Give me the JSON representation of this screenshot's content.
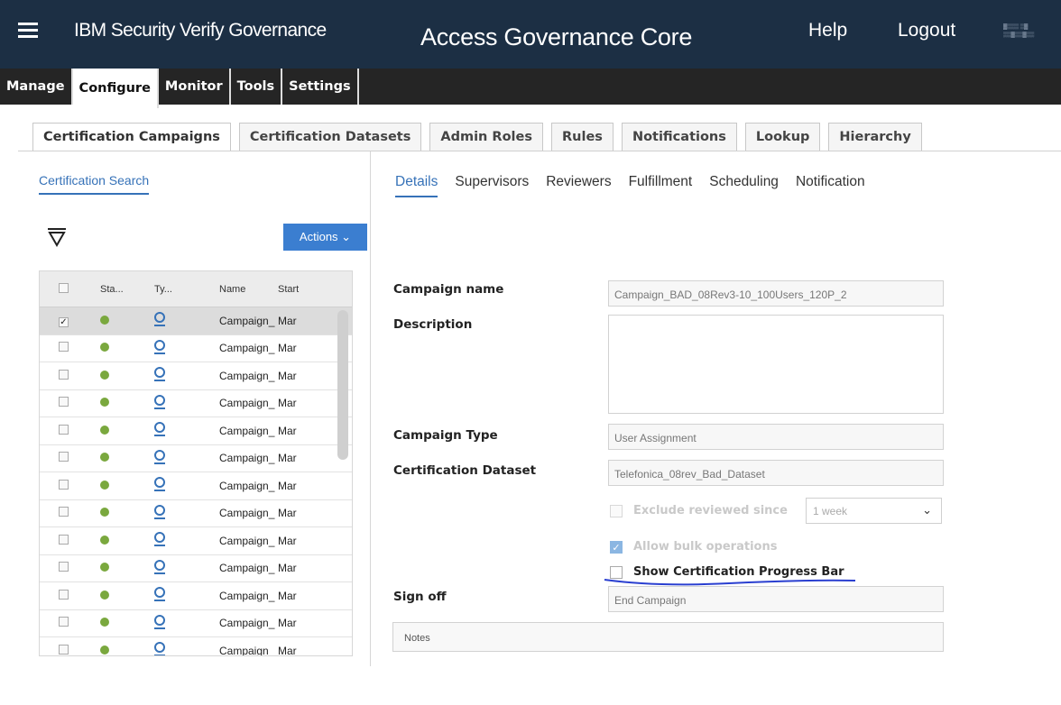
{
  "header": {
    "product": "IBM Security Verify Governance",
    "module": "Access Governance Core",
    "help": "Help",
    "logout": "Logout"
  },
  "menu": {
    "items": [
      "Manage",
      "Configure",
      "Monitor",
      "Tools",
      "Settings"
    ],
    "active": "Configure"
  },
  "subtabs": {
    "items": [
      "Certification Campaigns",
      "Certification Datasets",
      "Admin Roles",
      "Rules",
      "Notifications",
      "Lookup",
      "Hierarchy"
    ],
    "active": "Certification Campaigns"
  },
  "left": {
    "search_tab": "Certification Search",
    "actions_label": "Actions ⌄",
    "columns": [
      "Sta...",
      "Ty...",
      "Name",
      "Start"
    ],
    "rows": [
      {
        "name": "Campaign_",
        "start": "Mar",
        "checked": true
      },
      {
        "name": "Campaign_",
        "start": "Mar",
        "checked": false
      },
      {
        "name": "Campaign_",
        "start": "Mar",
        "checked": false
      },
      {
        "name": "Campaign_",
        "start": "Mar",
        "checked": false
      },
      {
        "name": "Campaign_",
        "start": "Mar",
        "checked": false
      },
      {
        "name": "Campaign_",
        "start": "Mar",
        "checked": false
      },
      {
        "name": "Campaign_",
        "start": "Mar",
        "checked": false
      },
      {
        "name": "Campaign_",
        "start": "Mar",
        "checked": false
      },
      {
        "name": "Campaign_",
        "start": "Mar",
        "checked": false
      },
      {
        "name": "Campaign_",
        "start": "Mar",
        "checked": false
      },
      {
        "name": "Campaign_",
        "start": "Mar",
        "checked": false
      },
      {
        "name": "Campaign_",
        "start": "Mar",
        "checked": false
      },
      {
        "name": "Campaign_",
        "start": "Mar",
        "checked": false
      }
    ]
  },
  "details": {
    "tabs": [
      "Details",
      "Supervisors",
      "Reviewers",
      "Fulfillment",
      "Scheduling",
      "Notification"
    ],
    "active_tab": "Details",
    "campaign_name_label": "Campaign name",
    "campaign_name_value": "Campaign_BAD_08Rev3-10_100Users_120P_2",
    "description_label": "Description",
    "campaign_type_label": "Campaign Type",
    "campaign_type_value": "User Assignment",
    "dataset_label": "Certification Dataset",
    "dataset_value": "Telefonica_08rev_Bad_Dataset",
    "exclude_label": "Exclude reviewed since",
    "exclude_value": "1 week",
    "bulk_label": "Allow bulk operations",
    "progress_label": "Show Certification Progress Bar",
    "signoff_label": "Sign off",
    "signoff_value": "End Campaign",
    "notes_label": "Notes"
  },
  "colors": {
    "header_bg": "#1c2f44",
    "accent": "#3672b8",
    "status_ok": "#7aa83e",
    "annotation": "#2a3fd0"
  }
}
